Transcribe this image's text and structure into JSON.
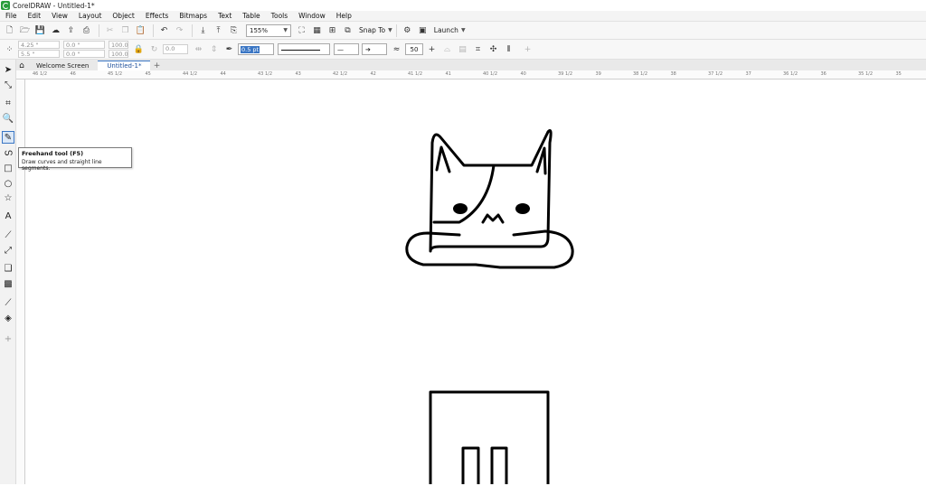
{
  "window": {
    "title": "CorelDRAW - Untitled-1*"
  },
  "menu": [
    "File",
    "Edit",
    "View",
    "Layout",
    "Object",
    "Effects",
    "Bitmaps",
    "Text",
    "Table",
    "Tools",
    "Window",
    "Help"
  ],
  "standard_toolbar": {
    "zoom_level": "155%",
    "snap_label": "Snap To",
    "launch_label": "Launch"
  },
  "property_bar": {
    "x": "4.25 \"",
    "y": "5.5 \"",
    "width": "0.0 \"",
    "height": "0.0 \"",
    "scale_x": "100.0",
    "scale_y": "100.0",
    "rotation": "0.0",
    "outline_width": "0.5 pt",
    "smoothing": "50"
  },
  "tabs": [
    {
      "label": "Welcome Screen"
    },
    {
      "label": "Untitled-1*"
    }
  ],
  "ruler_top_labels": [
    "46 1/2",
    "46",
    "45 1/2",
    "45",
    "44 1/2",
    "44",
    "43 1/2",
    "43",
    "42 1/2",
    "42",
    "41 1/2",
    "41",
    "40 1/2",
    "40",
    "39 1/2",
    "39",
    "38 1/2",
    "38",
    "37 1/2",
    "37",
    "36 1/2",
    "36",
    "35 1/2",
    "35"
  ],
  "tooltip": {
    "title": "Freehand tool (F5)",
    "description": "Draw curves and straight line segments."
  },
  "colors": {
    "accent": "#3a76c4",
    "canvas": "#ffffff",
    "logo": "#2a9d3b"
  }
}
